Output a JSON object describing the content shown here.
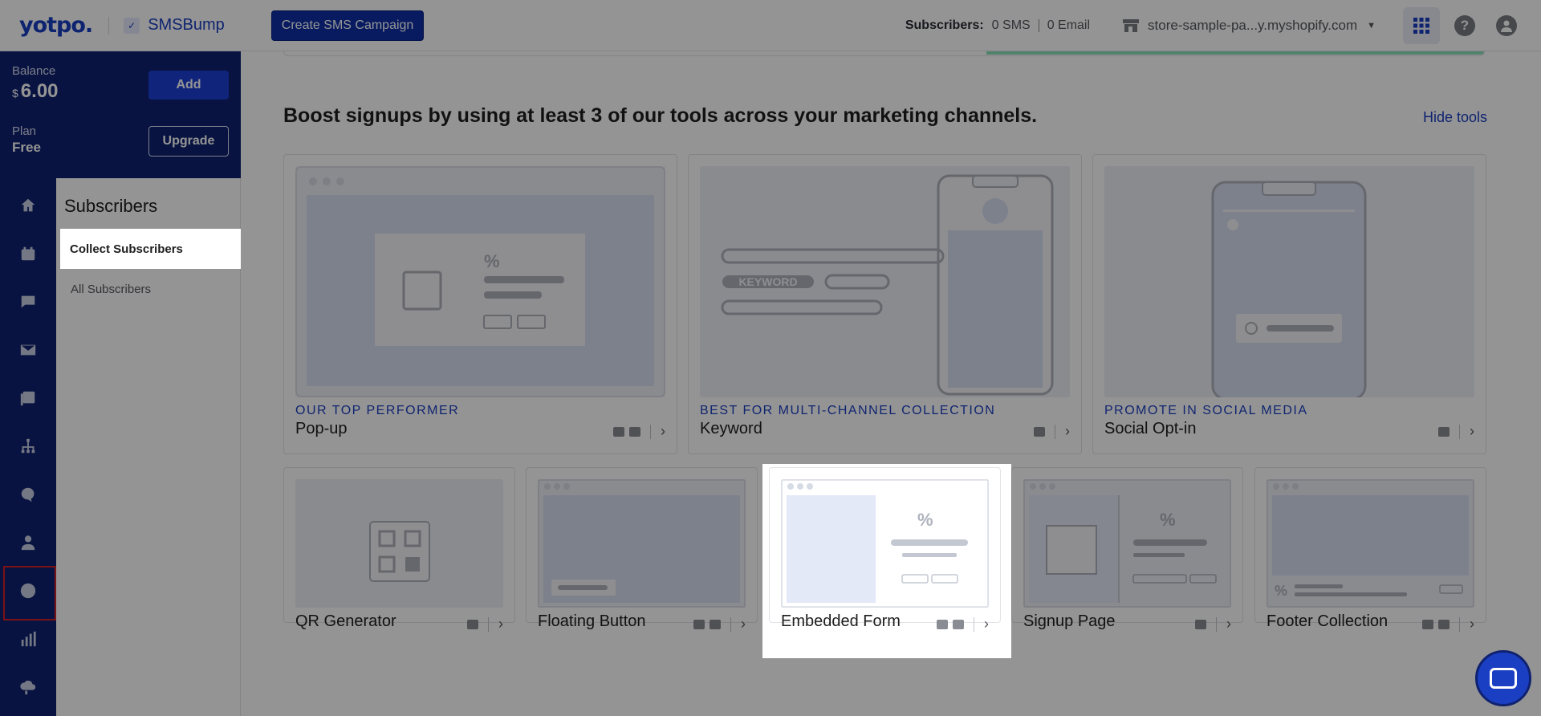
{
  "topbar": {
    "brand_logo": "yotpo.",
    "app_name": "SMSBump",
    "create_button": "Create SMS Campaign",
    "subscribers_label": "Subscribers:",
    "subscribers_sms": "0 SMS",
    "subscribers_email": "0 Email",
    "store_name": "store-sample-pa...y.myshopify.com"
  },
  "balance": {
    "label": "Balance",
    "currency": "$",
    "value": "6.00",
    "add_button": "Add",
    "plan_label": "Plan",
    "plan_value": "Free",
    "upgrade_button": "Upgrade"
  },
  "nav_icons": [
    "home-icon",
    "calendar-icon",
    "campaign-icon",
    "email-icon",
    "gallery-icon",
    "flows-icon",
    "chat-icon",
    "contacts-icon",
    "subscribers-icon",
    "analytics-icon",
    "integrations-icon"
  ],
  "subnav": {
    "title": "Subscribers",
    "items": [
      {
        "label": "Collect Subscribers",
        "active": true
      },
      {
        "label": "All Subscribers",
        "active": false
      }
    ]
  },
  "main": {
    "headline": "Boost signups by using at least 3 of our tools across your marketing channels.",
    "hide_tools": "Hide tools",
    "top_tools": [
      {
        "tag": "OUR TOP PERFORMER",
        "title": "Pop-up",
        "channels": [
          "email",
          "sms"
        ]
      },
      {
        "tag": "BEST FOR MULTI-CHANNEL COLLECTION",
        "title": "Keyword",
        "channels": [
          "sms"
        ]
      },
      {
        "tag": "PROMOTE IN SOCIAL MEDIA",
        "title": "Social Opt-in",
        "channels": [
          "sms"
        ]
      }
    ],
    "bottom_tools": [
      {
        "title": "QR Generator",
        "channels": [
          "sms"
        ]
      },
      {
        "title": "Floating Button",
        "channels": [
          "email",
          "sms"
        ]
      },
      {
        "title": "Embedded Form",
        "channels": [
          "email",
          "sms"
        ],
        "highlighted": true
      },
      {
        "title": "Signup Page",
        "channels": [
          "sms"
        ]
      },
      {
        "title": "Footer Collection",
        "channels": [
          "email",
          "sms"
        ]
      }
    ],
    "keyword_badge": "KEYWORD",
    "percent_glyph": "%"
  },
  "colors": {
    "brand_blue": "#1b3fc2",
    "sidebar_navy": "#0f2270",
    "highlight_red": "#d42027",
    "progress_green": "#8be0b8"
  }
}
